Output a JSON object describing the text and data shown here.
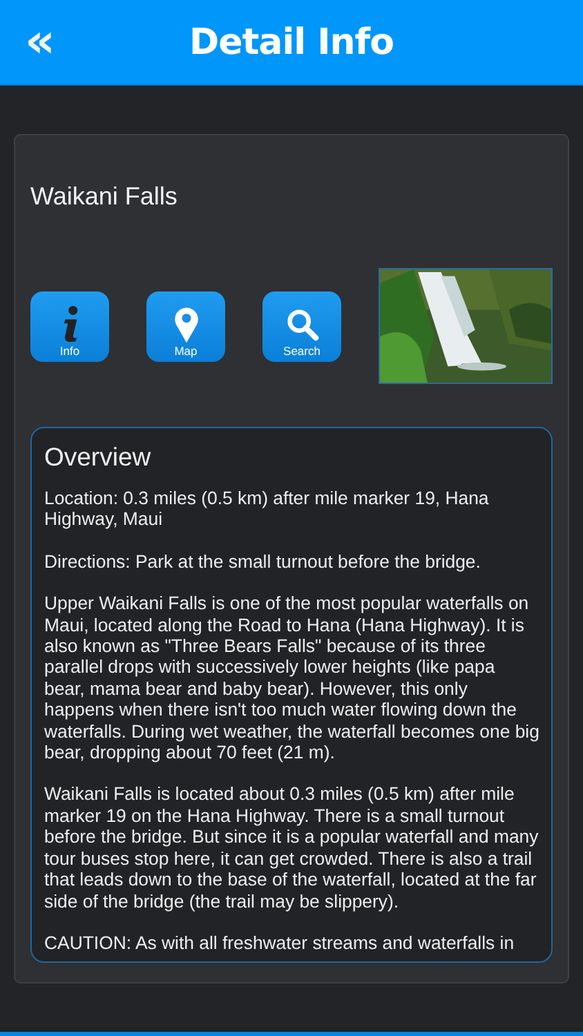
{
  "header": {
    "back_icon": "«",
    "title": "Detail Info"
  },
  "place": {
    "title": "Waikani Falls"
  },
  "actions": [
    {
      "kind": "info",
      "label": "Info"
    },
    {
      "kind": "map",
      "label": "Map"
    },
    {
      "kind": "search",
      "label": "Search"
    }
  ],
  "overview": {
    "heading": "Overview",
    "paragraphs": [
      "Location: 0.3 miles (0.5 km) after mile marker 19, Hana Highway, Maui",
      "Directions: Park at the small turnout before the bridge.",
      "Upper Waikani Falls is one of the most popular waterfalls on Maui, located along the Road to Hana (Hana Highway). It is also known as \"Three Bears Falls\" because of its three parallel drops with successively lower heights (like papa bear, mama bear and baby bear). However, this only happens when there isn't too much water flowing down the waterfalls. During wet weather, the waterfall becomes one big bear, dropping about 70 feet (21 m).",
      "Waikani Falls is located about 0.3 miles (0.5 km) after mile marker 19 on the Hana Highway. There is a small turnout before the bridge. But since it is a popular waterfall and many tour buses stop here, it can get crowded. There is also a trail that leads down to the base of the waterfall, located at the far side of the bridge (the trail may be slippery).",
      "CAUTION: As with all freshwater streams and waterfalls in"
    ]
  }
}
